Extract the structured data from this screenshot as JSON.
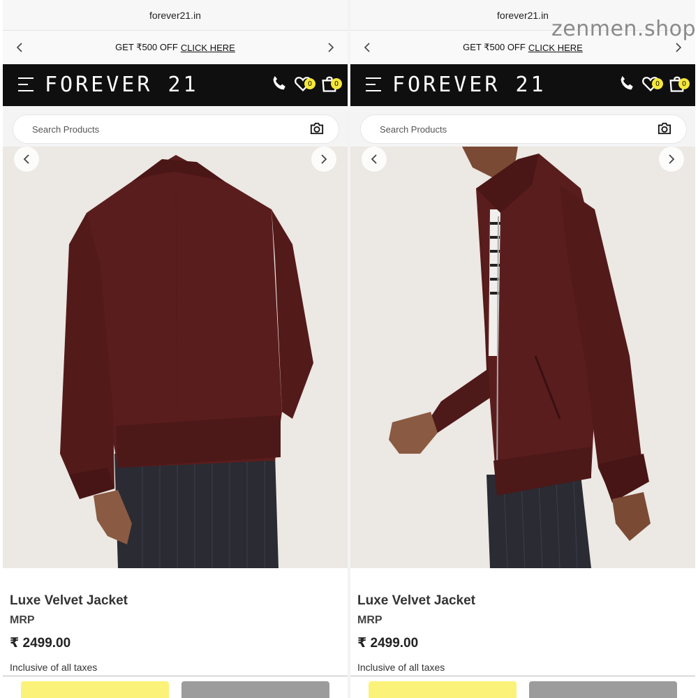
{
  "browser": {
    "url": "forever21.in"
  },
  "promo": {
    "text": "GET ₹500 OFF",
    "link_text": "CLICK HERE"
  },
  "header": {
    "logo_text": "FOREVER 21",
    "wishlist_count": "0",
    "cart_count": "0"
  },
  "search": {
    "placeholder": "Search Products"
  },
  "product": {
    "name": "Luxe Velvet Jacket",
    "mrp_label": "MRP",
    "price": "₹ 2499.00",
    "tax_note": "Inclusive of all taxes",
    "jacket_color": "#5a1d1d"
  },
  "watermark": "zenmen.shop",
  "icons": [
    "chevron-left-icon",
    "chevron-right-icon",
    "menu-icon",
    "phone-icon",
    "heart-icon",
    "bag-icon",
    "camera-icon"
  ]
}
